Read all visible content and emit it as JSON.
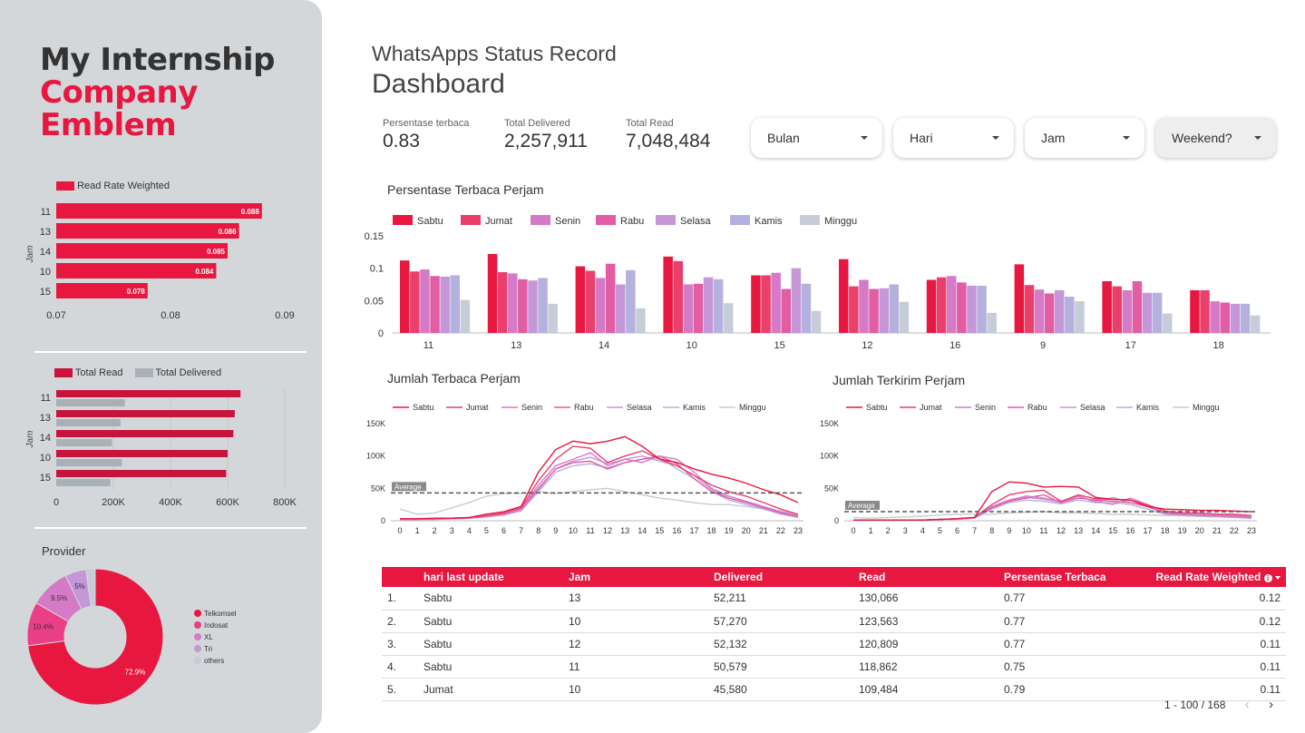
{
  "brand": {
    "line1": "My Internship",
    "line2": "Company",
    "line3": "Emblem"
  },
  "header": {
    "title": "WhatsApps Status Record",
    "subtitle": "Dashboard"
  },
  "kpis": [
    {
      "label": "Persentase terbaca",
      "value": "0.83"
    },
    {
      "label": "Total Delivered",
      "value": "2,257,911"
    },
    {
      "label": "Total Read",
      "value": "7,048,484"
    }
  ],
  "filters": [
    {
      "label": "Bulan"
    },
    {
      "label": "Hari"
    },
    {
      "label": "Jam"
    },
    {
      "label": "Weekend?"
    }
  ],
  "colors": {
    "accent": "#e8173f",
    "sidebar": "#d4d7da",
    "days": [
      "#e8173f",
      "#ea3f6b",
      "#d57ac7",
      "#e25da3",
      "#c596d8",
      "#b5b1df",
      "#c6ccd8"
    ]
  },
  "sidebar": {
    "rrw_legend": "Read Rate Weighted",
    "rrw_axis_title": "Jam",
    "tr_legend_read": "Total Read",
    "tr_legend_delivered": "Total Delivered",
    "tr_axis_title": "Jam",
    "provider_title": "Provider"
  },
  "chart_data": [
    {
      "type": "bar",
      "orientation": "horizontal",
      "categories": [
        "11",
        "13",
        "14",
        "10",
        "15"
      ],
      "series": [
        {
          "name": "Read Rate Weighted",
          "values": [
            0.088,
            0.086,
            0.085,
            0.084,
            0.078
          ]
        }
      ],
      "value_labels": [
        "0.088",
        "0.086",
        "0.085",
        "0.084",
        "0.078"
      ],
      "ylabel": "Jam",
      "xlim": [
        0.07,
        0.09
      ],
      "xticks": [
        "0.07",
        "0.08",
        "0.09"
      ]
    },
    {
      "type": "bar",
      "orientation": "horizontal",
      "categories": [
        "11",
        "13",
        "14",
        "10",
        "15"
      ],
      "series": [
        {
          "name": "Total Read",
          "values": [
            645000,
            625000,
            620000,
            600000,
            595000
          ]
        },
        {
          "name": "Total Delivered",
          "values": [
            240000,
            225000,
            195000,
            230000,
            190000
          ]
        }
      ],
      "ylabel": "Jam",
      "xlim": [
        0,
        800000
      ],
      "xticks": [
        "0",
        "200K",
        "400K",
        "600K",
        "800K"
      ]
    },
    {
      "type": "pie",
      "title": "Provider",
      "labels": [
        "Telkomsel",
        "Indosat",
        "XL",
        "Tri",
        "others"
      ],
      "values": [
        72.9,
        10.4,
        9.5,
        5.0,
        2.2
      ],
      "value_labels": [
        "72.9%",
        "10.4%",
        "9.5%",
        "5%"
      ],
      "colors": [
        "#e8173f",
        "#ea3f87",
        "#d57ac7",
        "#c596d8",
        "#c6ccd8"
      ]
    },
    {
      "type": "bar",
      "title": "Persentase Terbaca Perjam",
      "categories": [
        "11",
        "13",
        "14",
        "10",
        "15",
        "12",
        "16",
        "9",
        "17",
        "18"
      ],
      "ylim": [
        0,
        0.15
      ],
      "yticks": [
        "0",
        "0.05",
        "0.1",
        "0.15"
      ],
      "series": [
        {
          "name": "Sabtu",
          "values": [
            0.112,
            0.122,
            0.103,
            0.118,
            0.089,
            0.114,
            0.082,
            0.106,
            0.08,
            0.066
          ]
        },
        {
          "name": "Jumat",
          "values": [
            0.095,
            0.094,
            0.096,
            0.111,
            0.089,
            0.072,
            0.086,
            0.074,
            0.072,
            0.066
          ]
        },
        {
          "name": "Senin",
          "values": [
            0.098,
            0.092,
            0.085,
            0.075,
            0.093,
            0.082,
            0.088,
            0.067,
            0.066,
            0.049
          ]
        },
        {
          "name": "Rabu",
          "values": [
            0.088,
            0.083,
            0.107,
            0.076,
            0.068,
            0.068,
            0.078,
            0.061,
            0.08,
            0.047
          ]
        },
        {
          "name": "Selasa",
          "values": [
            0.087,
            0.081,
            0.075,
            0.086,
            0.1,
            0.069,
            0.073,
            0.066,
            0.062,
            0.045
          ]
        },
        {
          "name": "Kamis",
          "values": [
            0.089,
            0.085,
            0.097,
            0.083,
            0.076,
            0.075,
            0.073,
            0.056,
            0.062,
            0.045
          ]
        },
        {
          "name": "Minggu",
          "values": [
            0.051,
            0.045,
            0.038,
            0.046,
            0.034,
            0.048,
            0.031,
            0.049,
            0.03,
            0.027
          ]
        }
      ]
    },
    {
      "type": "line",
      "title": "Jumlah Terbaca Perjam",
      "x": [
        "0",
        "1",
        "2",
        "3",
        "4",
        "5",
        "6",
        "7",
        "8",
        "9",
        "10",
        "11",
        "12",
        "13",
        "14",
        "15",
        "16",
        "17",
        "18",
        "19",
        "20",
        "21",
        "22",
        "23"
      ],
      "ylim": [
        0,
        150000
      ],
      "yticks": [
        "0",
        "50K",
        "100K",
        "150K"
      ],
      "reference_line": {
        "label": "Average",
        "value": 43000
      },
      "series": [
        {
          "name": "Sabtu",
          "values": [
            3000,
            3000,
            4000,
            4000,
            5000,
            10000,
            14000,
            22000,
            75000,
            110000,
            123000,
            119000,
            123000,
            130000,
            115000,
            95000,
            90000,
            80000,
            72000,
            66000,
            58000,
            48000,
            40000,
            28000
          ]
        },
        {
          "name": "Jumat",
          "values": [
            3000,
            3000,
            3000,
            4000,
            5000,
            8000,
            12000,
            20000,
            62000,
            95000,
            115000,
            112000,
            90000,
            100000,
            108000,
            95000,
            85000,
            70000,
            55000,
            45000,
            38000,
            28000,
            18000,
            10000
          ]
        },
        {
          "name": "Senin",
          "values": [
            2000,
            2000,
            3000,
            3000,
            4000,
            7000,
            11000,
            18000,
            55000,
            85000,
            95000,
            105000,
            85000,
            95000,
            90000,
            100000,
            95000,
            75000,
            50000,
            38000,
            30000,
            22000,
            14000,
            8000
          ]
        },
        {
          "name": "Rabu",
          "values": [
            2000,
            2000,
            3000,
            3000,
            4000,
            7000,
            10000,
            18000,
            50000,
            80000,
            90000,
            92000,
            80000,
            90000,
            95000,
            100000,
            88000,
            65000,
            45000,
            35000,
            28000,
            20000,
            12000,
            7000
          ]
        },
        {
          "name": "Selasa",
          "values": [
            2000,
            2000,
            2000,
            3000,
            4000,
            6000,
            9000,
            16000,
            48000,
            80000,
            92000,
            98000,
            88000,
            95000,
            100000,
            92000,
            85000,
            70000,
            48000,
            35000,
            28000,
            20000,
            12000,
            6000
          ]
        },
        {
          "name": "Kamis",
          "values": [
            2000,
            2000,
            2000,
            3000,
            4000,
            6000,
            9000,
            15000,
            45000,
            75000,
            85000,
            88000,
            82000,
            90000,
            95000,
            98000,
            80000,
            65000,
            45000,
            32000,
            25000,
            18000,
            10000,
            5000
          ]
        },
        {
          "name": "Minggu",
          "values": [
            18000,
            10000,
            12000,
            20000,
            28000,
            38000,
            42000,
            42000,
            45000,
            42000,
            45000,
            48000,
            50000,
            45000,
            40000,
            35000,
            32000,
            28000,
            25000,
            25000,
            22000,
            18000,
            15000,
            10000
          ]
        }
      ]
    },
    {
      "type": "line",
      "title": "Jumlah Terkirim Perjam",
      "x": [
        "0",
        "1",
        "2",
        "3",
        "4",
        "5",
        "6",
        "7",
        "8",
        "9",
        "10",
        "11",
        "12",
        "13",
        "14",
        "15",
        "16",
        "17",
        "18",
        "19",
        "20",
        "21",
        "22",
        "23"
      ],
      "ylim": [
        0,
        150000
      ],
      "yticks": [
        "0",
        "50K",
        "100K",
        "150K"
      ],
      "reference_line": {
        "label": "Average",
        "value": 14000
      },
      "series": [
        {
          "name": "Sabtu",
          "values": [
            1000,
            1000,
            1000,
            1000,
            1000,
            2000,
            3000,
            5000,
            45000,
            60000,
            58000,
            52000,
            53000,
            52000,
            36000,
            33000,
            32000,
            22000,
            18000,
            17000,
            16000,
            16000,
            15000,
            14000
          ]
        },
        {
          "name": "Jumat",
          "values": [
            1000,
            1000,
            1000,
            1000,
            1000,
            2000,
            3000,
            5000,
            25000,
            40000,
            45000,
            47000,
            30000,
            40000,
            34000,
            33000,
            32000,
            24000,
            15000,
            12000,
            12000,
            10000,
            10000,
            8000
          ]
        },
        {
          "name": "Senin",
          "values": [
            1000,
            1000,
            1000,
            1000,
            1000,
            2000,
            3000,
            5000,
            22000,
            32000,
            38000,
            35000,
            30000,
            38000,
            30000,
            25000,
            35000,
            25000,
            15000,
            10000,
            10000,
            8000,
            8000,
            6000
          ]
        },
        {
          "name": "Rabu",
          "values": [
            1000,
            1000,
            1000,
            1000,
            1000,
            2000,
            3000,
            5000,
            20000,
            30000,
            35000,
            40000,
            28000,
            35000,
            32000,
            30000,
            28000,
            22000,
            12000,
            10000,
            9000,
            8000,
            7000,
            5000
          ]
        },
        {
          "name": "Selasa",
          "values": [
            1000,
            1000,
            1000,
            1000,
            1000,
            2000,
            3000,
            5000,
            20000,
            32000,
            36000,
            33000,
            28000,
            38000,
            28000,
            36000,
            28000,
            22000,
            12000,
            10000,
            8000,
            7000,
            6000,
            5000
          ]
        },
        {
          "name": "Kamis",
          "values": [
            1000,
            1000,
            1000,
            1000,
            1000,
            2000,
            2000,
            4000,
            18000,
            28000,
            32000,
            30000,
            26000,
            32000,
            28000,
            28000,
            25000,
            18000,
            10000,
            8000,
            7000,
            6000,
            5000,
            4000
          ]
        },
        {
          "name": "Minggu",
          "values": [
            5000,
            4000,
            5000,
            6000,
            7000,
            9000,
            10000,
            10000,
            10000,
            12000,
            13000,
            14000,
            12000,
            12000,
            11000,
            10000,
            10000,
            9000,
            8000,
            8000,
            7000,
            6000,
            5000,
            4000
          ]
        }
      ]
    }
  ],
  "table": {
    "columns": [
      "hari last update",
      "Jam",
      "Delivered",
      "Read",
      "Persentase Terbaca",
      "Read Rate Weighted"
    ],
    "rows": [
      {
        "n": "1.",
        "hari": "Sabtu",
        "jam": "13",
        "delivered": "52,211",
        "read": "130,066",
        "pct": "0.77",
        "rrw": "0.12"
      },
      {
        "n": "2.",
        "hari": "Sabtu",
        "jam": "10",
        "delivered": "57,270",
        "read": "123,563",
        "pct": "0.77",
        "rrw": "0.12"
      },
      {
        "n": "3.",
        "hari": "Sabtu",
        "jam": "12",
        "delivered": "52,132",
        "read": "120,809",
        "pct": "0.77",
        "rrw": "0.11"
      },
      {
        "n": "4.",
        "hari": "Sabtu",
        "jam": "11",
        "delivered": "50,579",
        "read": "118,862",
        "pct": "0.75",
        "rrw": "0.11"
      },
      {
        "n": "5.",
        "hari": "Jumat",
        "jam": "10",
        "delivered": "45,580",
        "read": "109,484",
        "pct": "0.79",
        "rrw": "0.11"
      }
    ],
    "pagination": "1 - 100 / 168"
  }
}
